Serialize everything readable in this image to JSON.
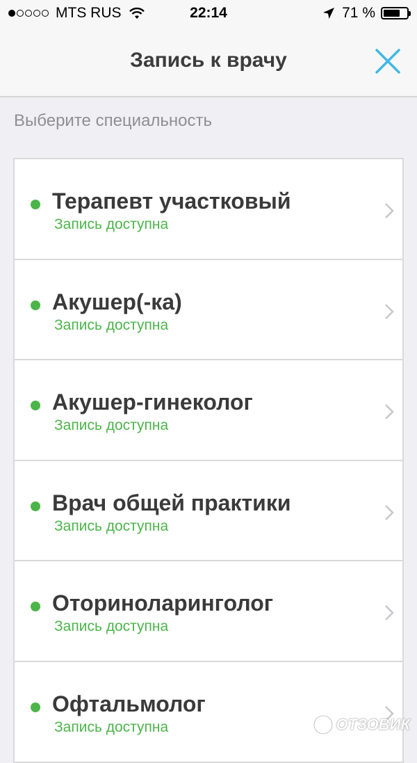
{
  "status_bar": {
    "carrier": "MTS RUS",
    "time": "22:14",
    "battery_percent": "71 %",
    "battery_level": 0.71,
    "signal_bars": 1
  },
  "nav": {
    "title": "Запись к врачу",
    "close_icon": "close-icon",
    "accent_color": "#3fb8e6"
  },
  "section_label": "Выберите специальность",
  "specialties": [
    {
      "name": "Терапевт участковый",
      "status": "Запись доступна"
    },
    {
      "name": "Акушер(-ка)",
      "status": "Запись доступна"
    },
    {
      "name": "Акушер-гинеколог",
      "status": "Запись доступна"
    },
    {
      "name": "Врач общей практики",
      "status": "Запись доступна"
    },
    {
      "name": "Оториноларинголог",
      "status": "Запись доступна"
    },
    {
      "name": "Офтальмолог",
      "status": "Запись доступна"
    }
  ],
  "colors": {
    "available_green": "#4cb54a",
    "background": "#efeff4"
  },
  "watermark": {
    "text": "ОТЗОВИК"
  }
}
